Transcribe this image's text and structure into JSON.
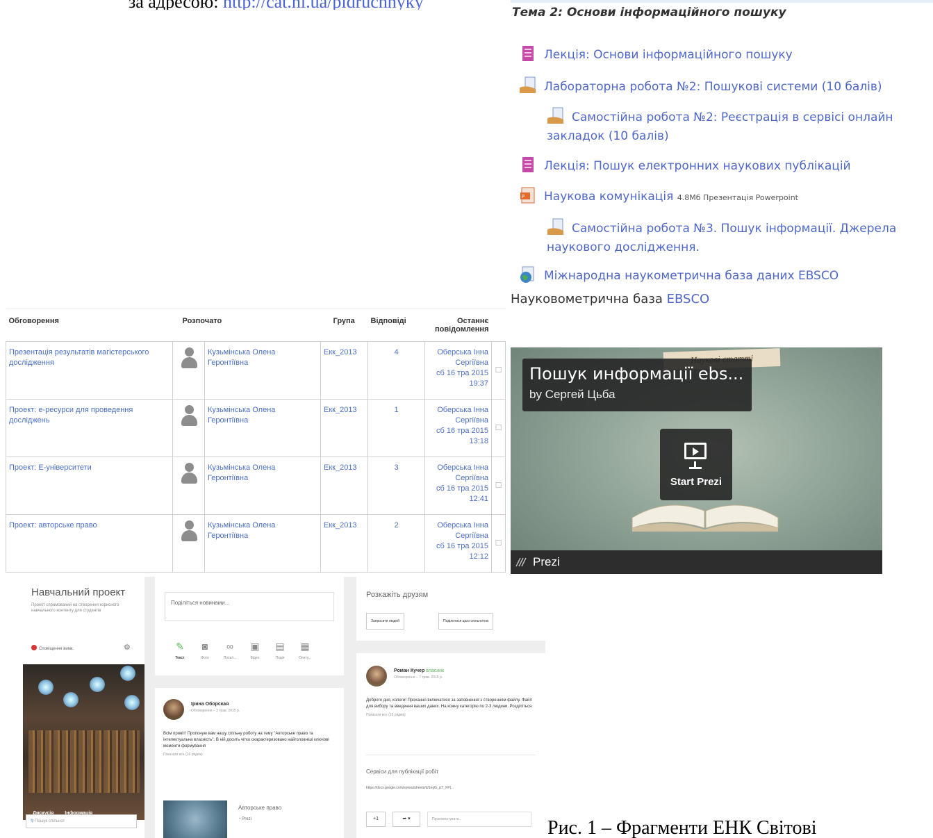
{
  "doc_top": {
    "text": "за адресою:",
    "link": "http://cat.nl.ua/pidruchnyky"
  },
  "course": {
    "topic_title": "Тема 2: Основи інформаційного пошуку",
    "items": [
      {
        "label": "Лекція: Основи інформаційного пошуку",
        "icon": "lecture-icon"
      },
      {
        "label": "Лабораторна робота №2: Пошукові системи (10 балів)",
        "icon": "assignment-icon"
      },
      {
        "label": "Самостійна робота №2: Реєстрація в сервісі онлайн закладок (10 балів)",
        "icon": "assignment-icon"
      },
      {
        "label": "Лекція: Пошук електронних наукових публікацій",
        "icon": "lecture-icon"
      },
      {
        "label": "Наукова комунікація",
        "meta": "4.8Мб Презентація Powerpoint",
        "icon": "powerpoint-icon"
      },
      {
        "label": "Самостійна робота №3. Пошук інформації. Джерела наукового дослідження.",
        "icon": "assignment-icon"
      },
      {
        "label": "Міжнародна наукометрична база даних EBSCO",
        "icon": "url-globe-icon"
      }
    ],
    "note_text": "Науковометрична база",
    "note_link": "EBSCO"
  },
  "forum": {
    "headers": [
      "Обговорення",
      "Розпочато",
      "Група",
      "Відповіді",
      "Останнє повідомлення"
    ],
    "rows": [
      {
        "topic": "Презентація результатів магістерського дослідження",
        "author": "Кузьмінська Олена Геронтіївна",
        "group": "Екк_2013",
        "replies": "4",
        "last_author": "Оберська Інна Сергіївна",
        "last_date": "сб 16 тра 2015",
        "last_time": "19:37"
      },
      {
        "topic": "Проект: е-ресурси для проведення досліджень",
        "author": "Кузьмінська Олена Геронтіївна",
        "group": "Екк_2013",
        "replies": "1",
        "last_author": "Оберська Інна Сергіївна",
        "last_date": "сб 16 тра 2015",
        "last_time": "13:18"
      },
      {
        "topic": "Проект: Е-університети",
        "author": "Кузьмінська Олена Геронтіївна",
        "group": "Екк_2013",
        "replies": "3",
        "last_author": "Оберська Інна Сергіївна",
        "last_date": "сб 16 тра 2015",
        "last_time": "12:41"
      },
      {
        "topic": "Проект: авторське право",
        "author": "Кузьмінська Олена Геронтіївна",
        "group": "Екк_2013",
        "replies": "2",
        "last_author": "Оберська Інна Сергіївна",
        "last_date": "сб 16 тра 2015",
        "last_time": "12:12"
      }
    ]
  },
  "prezi": {
    "ribbon": "Наукові статті",
    "title": "Пошук информації ebs...",
    "author": "by Сергей Цьба",
    "start_label": "Start Prezi",
    "footer": "Prezi"
  },
  "social": {
    "project_name": "Навчальний проект",
    "project_desc": "Проект спрямований на створення корисного навчального контенту для студентів",
    "notifications": "Сповіщення вимк.",
    "cover_tabs": [
      "Дискусія",
      "Інформація"
    ],
    "search_placeholder": "Пошук спільнот",
    "share_placeholder": "Поділіться новинами...",
    "share_types": [
      {
        "icon": "pen-icon",
        "label": "Текст"
      },
      {
        "icon": "camera-icon",
        "label": "Фото"
      },
      {
        "icon": "link-icon",
        "label": "Посил..."
      },
      {
        "icon": "video-icon",
        "label": "Відео"
      },
      {
        "icon": "calendar-icon",
        "label": "Подія"
      },
      {
        "icon": "poll-icon",
        "label": "Опиту..."
      }
    ],
    "post1": {
      "author": "Ірина Оборская",
      "meta": "Обговорення – 3 трав. 2015 р.",
      "text": "Всім привіт! Пропоную вам нашу спільну роботу на тему \"Авторське право та інтелектуальна власність\". В ній досить чітко охарактеризовано найголовніші ключові моменти формування",
      "more": "Показати все (16 рядків)",
      "attach_title": "Авторське право",
      "attach_source": "Prezi"
    },
    "tell_title": "Розкажіть друзям",
    "tell_buttons": [
      "Запросити людей",
      "Поділитися цією спільнотою"
    ],
    "post2": {
      "author": "Роман Кучер",
      "author_tag": "власник",
      "meta": "Обговорення – 7 трав. 2015 р.",
      "text": "Доброго дня, колеги! Прохання включатися за заповнення з створенням файлу. Файл для вибору та введення ваших даних. На кожну категорію по 2-3 людини. Розділіться",
      "more": "Показати все (16 рядків)",
      "service_title": "Сервіси для публікації робіт",
      "service_url": "https://docs.google.com/spreadsheets/d/1egG_jcT_FP|...",
      "plus_label": "+1",
      "share_label": "➦",
      "comment_placeholder": "Прокоментувати..."
    }
  },
  "caption": "Рис. 1 – Фрагменти ЕНК Світові"
}
